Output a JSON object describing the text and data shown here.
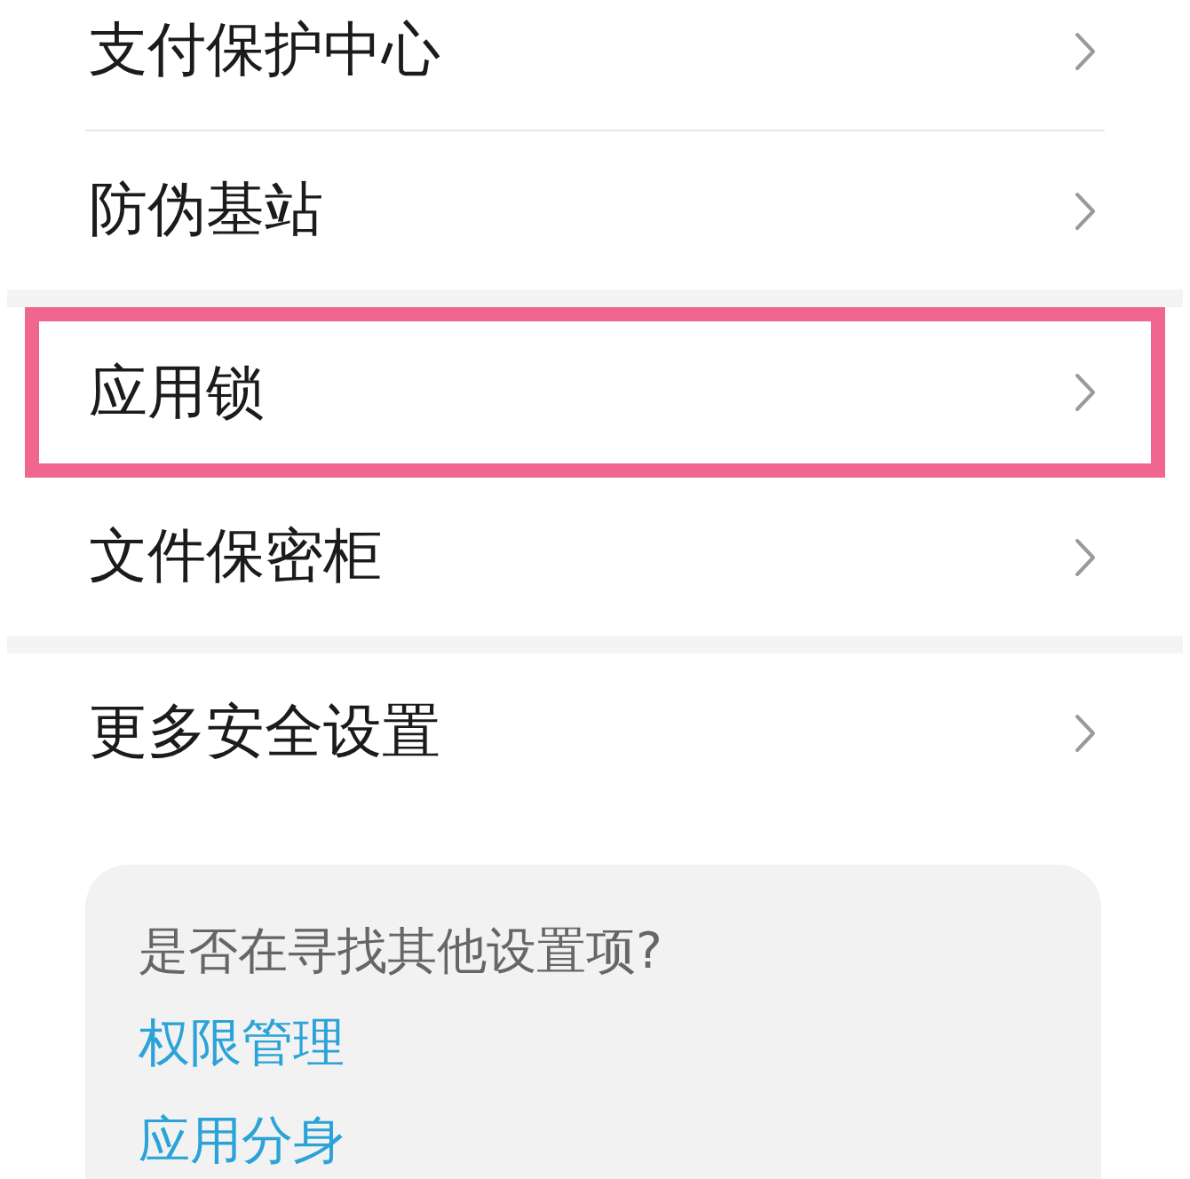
{
  "sections": [
    {
      "items": [
        {
          "label": "支付保护中心",
          "highlighted": false
        },
        {
          "label": "防伪基站",
          "highlighted": false
        }
      ]
    },
    {
      "items": [
        {
          "label": "应用锁",
          "highlighted": true
        },
        {
          "label": "文件保密柜",
          "highlighted": false
        }
      ]
    },
    {
      "items": [
        {
          "label": "更多安全设置",
          "highlighted": false
        }
      ]
    }
  ],
  "suggestions": {
    "title": "是否在寻找其他设置项?",
    "links": [
      "权限管理",
      "应用分身"
    ]
  }
}
